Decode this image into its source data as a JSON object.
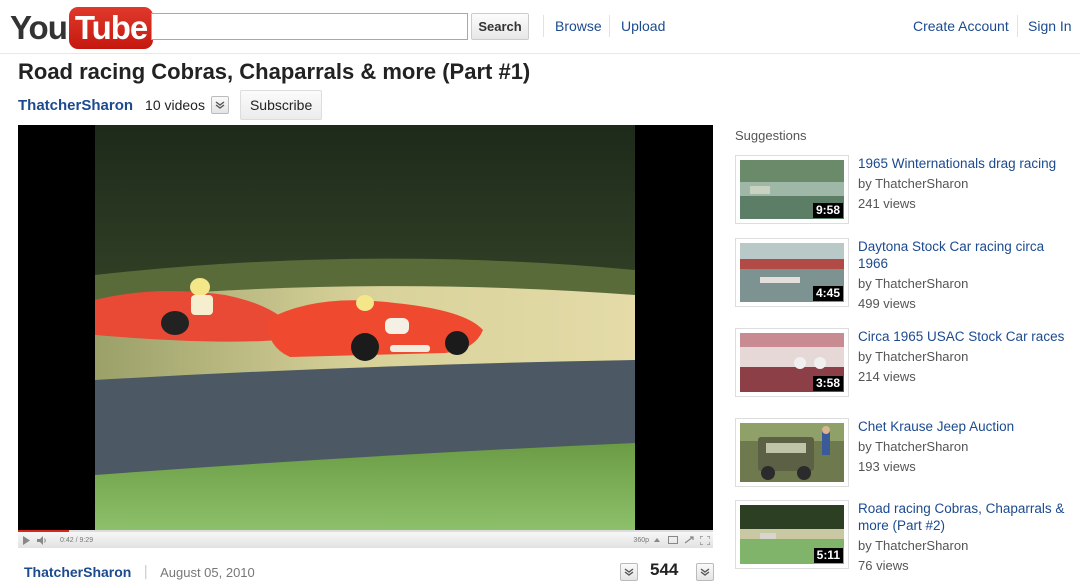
{
  "header": {
    "logo_you": "You",
    "logo_tube": "Tube",
    "search_value": "",
    "search_button": "Search",
    "nav": [
      "Browse",
      "Upload"
    ],
    "account": [
      "Create Account",
      "Sign In"
    ]
  },
  "video": {
    "title": "Road racing Cobras, Chaparrals & more (Part #1)",
    "channel": "ThatcherSharon",
    "video_count": "10 videos",
    "subscribe_label": "Subscribe",
    "time_display": "0:42 / 9:29",
    "quality": "360p",
    "progress": 0.074,
    "uploaded": "August 05, 2010",
    "views": "544"
  },
  "suggestions": {
    "heading": "Suggestions",
    "items": [
      {
        "title": "1965 Winternationals drag racing",
        "by": "by ThatcherSharon",
        "views": "241 views",
        "duration": "9:58"
      },
      {
        "title": "Daytona Stock Car racing circa 1966",
        "by": "by ThatcherSharon",
        "views": "499 views",
        "duration": "4:45"
      },
      {
        "title": "Circa 1965 USAC Stock Car races",
        "by": "by ThatcherSharon",
        "views": "214 views",
        "duration": "3:58"
      },
      {
        "title": "Chet Krause Jeep Auction",
        "by": "by ThatcherSharon",
        "views": "193 views",
        "duration": ""
      },
      {
        "title": "Road racing Cobras, Chaparrals & more (Part #2)",
        "by": "by ThatcherSharon",
        "views": "76 views",
        "duration": "5:11"
      }
    ]
  },
  "colors": {
    "link": "#1c4a8f",
    "logo_red": "#d8281d"
  },
  "icons": [
    "play-icon",
    "volume-icon",
    "quality-icon",
    "popout-icon",
    "expand-icon",
    "fullscreen-icon",
    "chevron-down-icon"
  ]
}
